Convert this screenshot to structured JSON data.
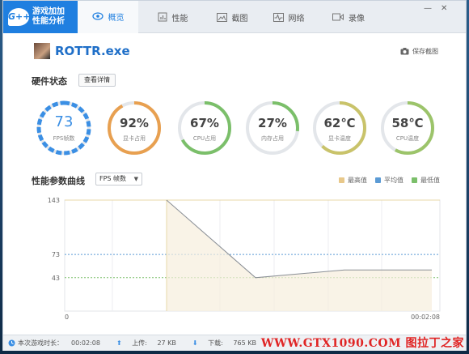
{
  "header": {
    "logo_line1": "游戏加加",
    "logo_line2": "性能分析",
    "logo_badge": "G++",
    "tabs": [
      {
        "label": "概览",
        "icon": "eye-icon",
        "active": true
      },
      {
        "label": "性能",
        "icon": "bar-chart-icon",
        "active": false
      },
      {
        "label": "截图",
        "icon": "image-icon",
        "active": false
      },
      {
        "label": "网络",
        "icon": "pulse-icon",
        "active": false
      },
      {
        "label": "录像",
        "icon": "video-icon",
        "active": false
      }
    ],
    "minimize": "—",
    "close": "✕"
  },
  "app": {
    "name": "ROTTR.exe",
    "save_screenshot": "保存截图"
  },
  "hardware": {
    "title": "硬件状态",
    "details_button": "查看详情",
    "gauges": [
      {
        "value": "73",
        "label": "FPS帧数",
        "percent": 0.8,
        "color": "#3b8fe4",
        "style": "dashed"
      },
      {
        "value": "92%",
        "label": "显卡占用",
        "percent": 0.92,
        "color": "#e8a050",
        "style": "arc"
      },
      {
        "value": "67%",
        "label": "CPU占用",
        "percent": 0.67,
        "color": "#7bbf6a",
        "style": "arc"
      },
      {
        "value": "27%",
        "label": "内存占用",
        "percent": 0.27,
        "color": "#7bbf6a",
        "style": "arc"
      },
      {
        "value": "62℃",
        "label": "显卡温度",
        "percent": 0.62,
        "color": "#c9c36a",
        "style": "arc"
      },
      {
        "value": "58℃",
        "label": "CPU温度",
        "percent": 0.58,
        "color": "#9cc46a",
        "style": "arc"
      }
    ]
  },
  "curve": {
    "title": "性能参数曲线",
    "select_value": "FPS 帧数",
    "legend": [
      {
        "label": "最高值",
        "color": "#e8c88a"
      },
      {
        "label": "平均值",
        "color": "#5b9bd5"
      },
      {
        "label": "最低值",
        "color": "#7bbf6a"
      }
    ]
  },
  "chart_data": {
    "type": "line",
    "y_ticks": [
      "143",
      "73",
      "43"
    ],
    "x_tick_labels": [
      "0",
      "00:02:08"
    ],
    "max_value": 143,
    "avg_value": 73,
    "min_value": 43,
    "series": [
      {
        "values": [
          143,
          43,
          53,
          53
        ]
      }
    ]
  },
  "footer": {
    "duration_label": "本次游戏时长：",
    "duration": "00:02:08",
    "upload_label": "上传:",
    "upload": "27 KB",
    "download_label": "下载:",
    "download": "765 KB"
  },
  "watermark": "WWW.GTX1090.COM 图拉丁之家"
}
